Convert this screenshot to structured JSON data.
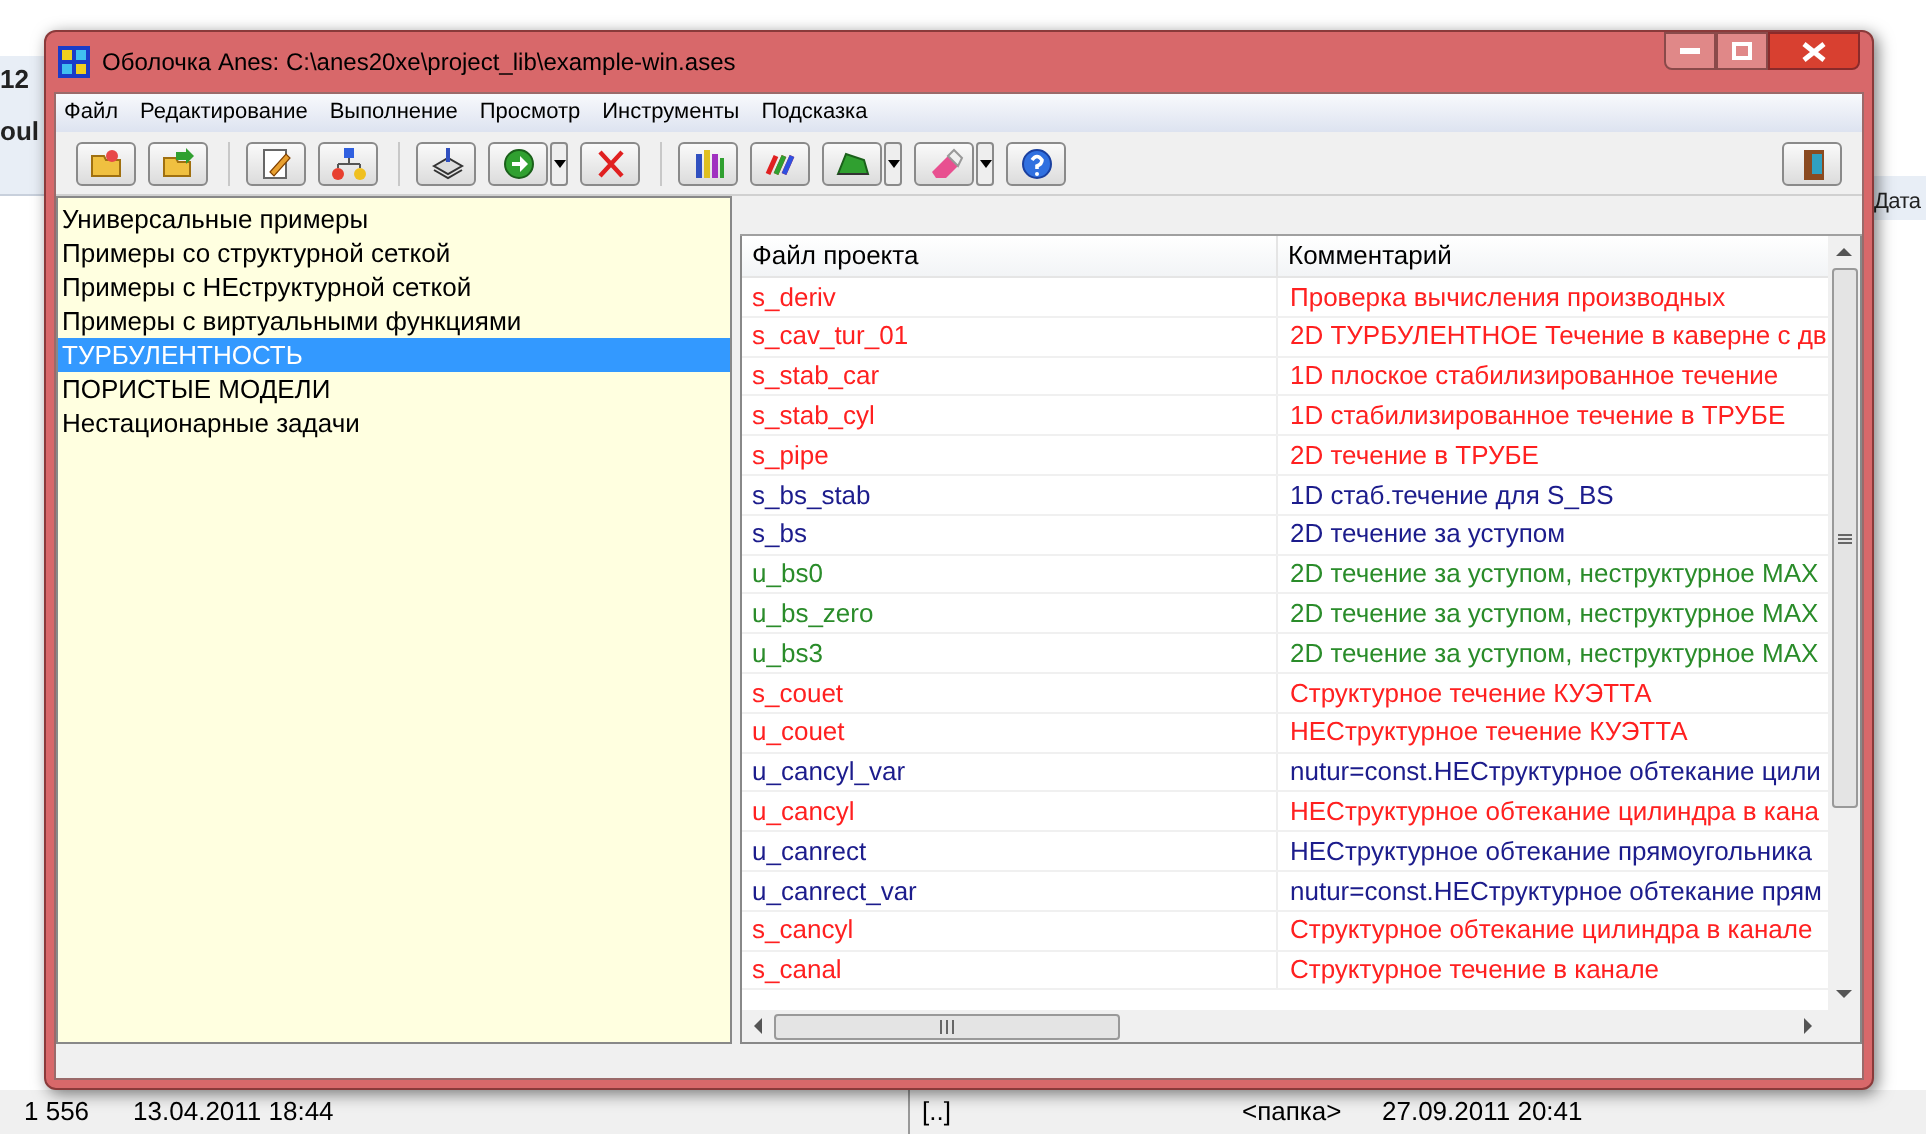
{
  "background": {
    "left_texts": [
      "12",
      "oul"
    ],
    "right_text": "Дата",
    "status": [
      {
        "text": "1 556"
      },
      {
        "text": "13.04.2011 18:44"
      }
    ],
    "status_right": [
      {
        "text": "[..]"
      },
      {
        "text": "<папка>"
      },
      {
        "text": "27.09.2011 20:41"
      }
    ]
  },
  "window": {
    "title": "Оболочка Anes: C:\\anes20xe\\project_lib\\example-win.ases"
  },
  "menu": [
    "Файл",
    "Редактирование",
    "Выполнение",
    "Просмотр",
    "Инструменты",
    "Подсказка"
  ],
  "sidebar": {
    "items": [
      {
        "label": "Универсальные примеры",
        "selected": false
      },
      {
        "label": "Примеры со структурной сеткой",
        "selected": false
      },
      {
        "label": "Примеры с НЕструктурной сеткой",
        "selected": false
      },
      {
        "label": "Примеры с виртуальными функциями",
        "selected": false
      },
      {
        "label": "ТУРБУЛЕНТНОСТЬ",
        "selected": true
      },
      {
        "label": "ПОРИСТЫЕ МОДЕЛИ",
        "selected": false
      },
      {
        "label": "Нестационарные задачи",
        "selected": false
      }
    ]
  },
  "table": {
    "columns": [
      "Файл проекта",
      "Комментарий"
    ],
    "rows": [
      {
        "file": "s_deriv",
        "comment": "Проверка вычисления производных",
        "color": "#ff2020"
      },
      {
        "file": "s_cav_tur_01",
        "comment": "2D ТУРБУЛЕНТНОЕ Течение в каверне с дв",
        "color": "#ff2020"
      },
      {
        "file": "s_stab_car",
        "comment": "1D плоское стабилизированное течение",
        "color": "#ff2020"
      },
      {
        "file": "s_stab_cyl",
        "comment": "1D стабилизированное течение в ТРУБЕ",
        "color": "#ff2020"
      },
      {
        "file": "s_pipe",
        "comment": "2D течение в ТРУБЕ",
        "color": "#ff2020"
      },
      {
        "file": "s_bs_stab",
        "comment": "1D стаб.течение для S_BS",
        "color": "#1c1c8c"
      },
      {
        "file": "s_bs",
        "comment": "2D течение за уступом",
        "color": "#1c1c8c"
      },
      {
        "file": "u_bs0",
        "comment": "2D течение за уступом, неструктурное MAX",
        "color": "#2a8c2a"
      },
      {
        "file": "u_bs_zero",
        "comment": "2D течение за уступом, неструктурное MAX",
        "color": "#2a8c2a"
      },
      {
        "file": "u_bs3",
        "comment": "2D течение за уступом, неструктурное MAX",
        "color": "#2a8c2a"
      },
      {
        "file": "s_couet",
        "comment": "Структурное течение КУЭТТА",
        "color": "#ff2020"
      },
      {
        "file": "u_couet",
        "comment": "НЕСтруктурное течение КУЭТТА",
        "color": "#ff2020"
      },
      {
        "file": "u_cancyl_var",
        "comment": "nutur=const.НЕСтруктурное обтекание цили",
        "color": "#1c1c8c"
      },
      {
        "file": "u_cancyl",
        "comment": "НЕСтруктурное обтекание цилиндра в кана",
        "color": "#ff2020"
      },
      {
        "file": "u_canrect",
        "comment": "НЕСтруктурное обтекание прямоугольника",
        "color": "#1c1c8c"
      },
      {
        "file": "u_canrect_var",
        "comment": "nutur=const.НЕСтруктурное обтекание прям",
        "color": "#1c1c8c"
      },
      {
        "file": "s_cancyl",
        "comment": "Структурное обтекание цилиндра в канале",
        "color": "#ff2020"
      },
      {
        "file": "s_canal",
        "comment": "Структурное течение в канале",
        "color": "#ff2020"
      }
    ]
  }
}
